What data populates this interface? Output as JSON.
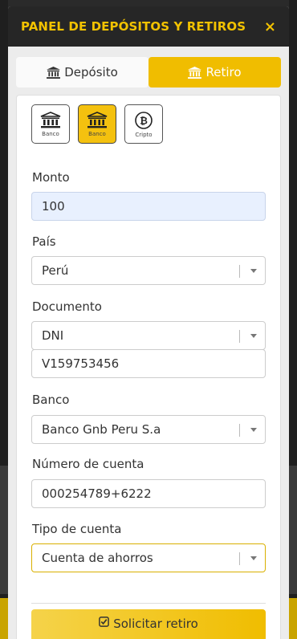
{
  "modal": {
    "title": "PANEL DE DEPÓSITOS Y RETIROS",
    "close_glyph": "×"
  },
  "tabs": [
    {
      "label": "Depósito",
      "icon": "bank-icon",
      "active": false
    },
    {
      "label": "Retiro",
      "icon": "bank-icon",
      "active": true
    }
  ],
  "methods": [
    {
      "label": "Banco",
      "icon": "bank-icon",
      "selected": false
    },
    {
      "label": "Banco",
      "icon": "bank-icon",
      "selected": true
    },
    {
      "label": "Cripto",
      "icon": "bitcoin-icon",
      "selected": false
    }
  ],
  "form": {
    "amount": {
      "label": "Monto",
      "value": "100"
    },
    "country": {
      "label": "País",
      "value": "Perú"
    },
    "document": {
      "label": "Documento",
      "type": "DNI",
      "number": "V159753456"
    },
    "bank": {
      "label": "Banco",
      "value": "Banco Gnb Peru S.a"
    },
    "account_number": {
      "label": "Número de cuenta",
      "value": "000254789+6222"
    },
    "account_type": {
      "label": "Tipo de cuenta",
      "value": "Cuenta de ahorros"
    }
  },
  "submit": {
    "label": "Solicitar retiro",
    "icon": "check-square-icon"
  },
  "colors": {
    "accent": "#f0bd00",
    "header_bg": "#262626",
    "title": "#f2c200"
  }
}
